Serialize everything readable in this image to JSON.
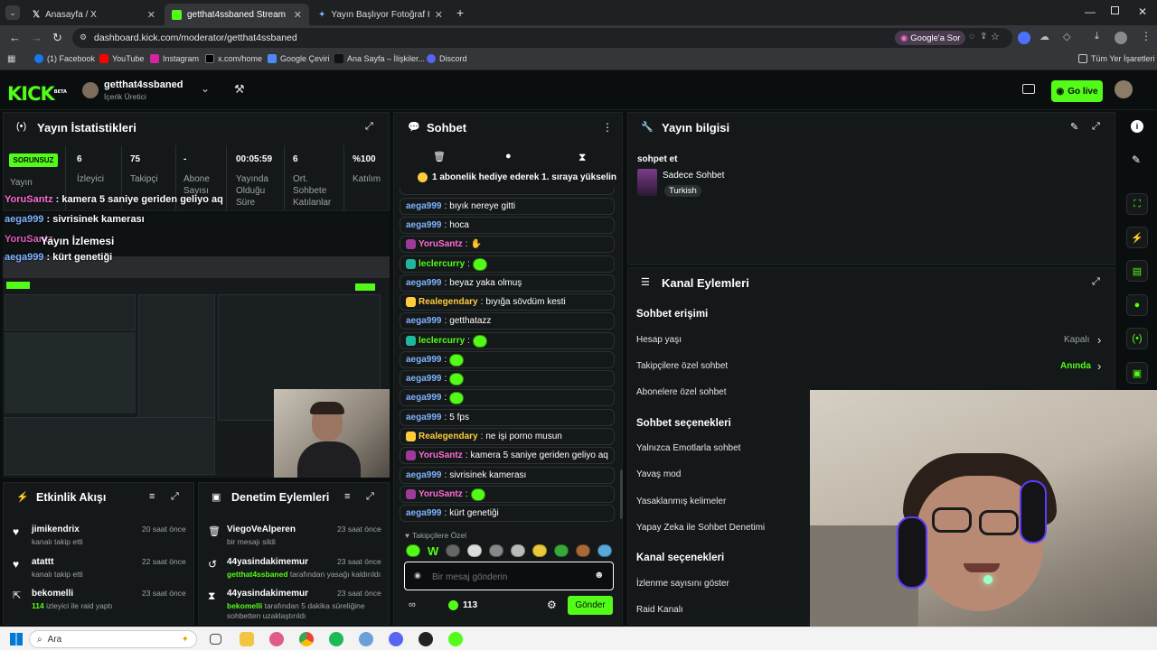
{
  "browser": {
    "tabs": [
      {
        "title": "Anasayfa / X"
      },
      {
        "title": "getthat4ssbaned Stream - Kick"
      },
      {
        "title": "Yayın Başlıyor Fotoğraf Hazırlan"
      }
    ],
    "url": "dashboard.kick.com/moderator/getthat4ssbaned",
    "ask_google": "Google'a Sor",
    "bookmarks": [
      "(1) Facebook",
      "YouTube",
      "Instagram",
      "x.com/home",
      "Google Çeviri",
      "Ana Sayfa – İlişkiler...",
      "Discord"
    ],
    "all_bookmarks": "Tüm Yer İşaretleri"
  },
  "kick": {
    "logo": "KICK",
    "beta": "BETA",
    "channel_name": "getthat4ssbaned",
    "channel_role": "İçerik Üretici",
    "go_live": "Go live"
  },
  "stats": {
    "title": "Yayın İstatistikleri",
    "status_badge": "SORUNSUZ",
    "status_label": "Yayın",
    "items": [
      {
        "value": "6",
        "label": "İzleyici"
      },
      {
        "value": "75",
        "label": "Takipçi"
      },
      {
        "value": "-",
        "label": "Abone Sayısı"
      },
      {
        "value": "00:05:59",
        "label": "Yayında Olduğu Süre"
      },
      {
        "value": "6",
        "label": "Ort. Sohbete Katılanlar"
      },
      {
        "value": "%100",
        "label": "Katılım"
      }
    ]
  },
  "stream_overlay": {
    "lines": [
      {
        "user": "YoruSantz",
        "text": " : kamera 5 saniye geriden geliyo aq"
      },
      {
        "user": "aega999",
        "text": " : sivrisinek kamerası"
      },
      {
        "user": "YoruSantz",
        "text": "Yayın İzlemesi"
      },
      {
        "user": "aega999",
        "text": " : kürt genetiği"
      }
    ]
  },
  "activity": {
    "title": "Etkinlik Akışı",
    "items": [
      {
        "user": "jimikendrix",
        "desc": "kanalı takip etti",
        "time": "20 saat önce"
      },
      {
        "user": "atattt",
        "desc": "kanalı takip etti",
        "time": "22 saat önce"
      },
      {
        "user": "bekomelli",
        "count": "114",
        "desc": "izleyici ile raid yaptı",
        "time": "23 saat önce"
      }
    ]
  },
  "moderation": {
    "title": "Denetim Eylemleri",
    "items": [
      {
        "user": "ViegoVeAlperen",
        "desc": "bir mesajı sildi",
        "time": "23 saat önce"
      },
      {
        "user": "44yasindakimemur",
        "actor": "getthat4ssbaned",
        "desc": "tarafından yasağı kaldırıldı",
        "time": "23 saat önce"
      },
      {
        "user": "44yasindakimemur",
        "actor": "bekomelli",
        "desc": "tarafından 5 dakika süreliğine sohbetten uzaklaştırıldı",
        "time": "23 saat önce"
      }
    ]
  },
  "chat": {
    "title": "Sohbet",
    "gift_banner": "1 abonelik hediye ederek 1. sıraya yükselin",
    "messages": [
      {
        "user": "aega999",
        "text": "bıyık nereye gitti",
        "color": "blue"
      },
      {
        "user": "aega999",
        "text": "hoca",
        "color": "blue"
      },
      {
        "user": "YoruSantz",
        "text": "",
        "color": "pink",
        "emote": "hand"
      },
      {
        "user": "leclercurry",
        "text": "",
        "color": "green",
        "emote": "kick"
      },
      {
        "user": "aega999",
        "text": "beyaz yaka olmuş",
        "color": "blue"
      },
      {
        "user": "Realegendary",
        "text": "bıyığa sövdüm kesti",
        "color": "yellow"
      },
      {
        "user": "aega999",
        "text": "getthatazz",
        "color": "blue"
      },
      {
        "user": "leclercurry",
        "text": "",
        "color": "green",
        "emote": "kick"
      },
      {
        "user": "aega999",
        "text": "",
        "color": "blue",
        "emote": "kick"
      },
      {
        "user": "aega999",
        "text": "",
        "color": "blue",
        "emote": "kick"
      },
      {
        "user": "aega999",
        "text": "",
        "color": "blue",
        "emote": "kick"
      },
      {
        "user": "aega999",
        "text": "5 fps",
        "color": "blue"
      },
      {
        "user": "Realegendary",
        "text": "ne işi porno musun",
        "color": "yellow"
      },
      {
        "user": "YoruSantz",
        "text": "kamera 5 saniye geriden geliyo aq",
        "color": "pink"
      },
      {
        "user": "aega999",
        "text": "sivrisinek kamerası",
        "color": "blue"
      },
      {
        "user": "YoruSantz",
        "text": "",
        "color": "pink",
        "emote": "kick"
      },
      {
        "user": "aega999",
        "text": "kürt genetiği",
        "color": "blue"
      }
    ],
    "follower_only": "Takipçilere Özel",
    "input_placeholder": "Bir mesaj gönderin",
    "points": "113",
    "send": "Gönder"
  },
  "stream_info": {
    "title": "Yayın bilgisi",
    "stream_title": "sohpet et",
    "category": "Sadece Sohbet",
    "language": "Turkish"
  },
  "channel_actions": {
    "title": "Kanal Eylemleri",
    "sections": [
      {
        "heading": "Sohbet erişimi"
      },
      {
        "heading": "Sohbet seçenekleri"
      },
      {
        "heading": "Kanal seçenekleri"
      }
    ],
    "rows": [
      {
        "label": "Hesap yaşı",
        "value": "Kapalı"
      },
      {
        "label": "Takipçilere özel sohbet",
        "value": "Anında"
      },
      {
        "label": "Abonelere özel sohbet",
        "value": ""
      },
      {
        "label": "Yalnızca Emotlarla sohbet",
        "value": ""
      },
      {
        "label": "Yavaş mod",
        "value": ""
      },
      {
        "label": "Yasaklanmış kelimeler",
        "value": ""
      },
      {
        "label": "Yapay Zeka ile Sohbet Denetimi",
        "value": ""
      },
      {
        "label": "İzlenme sayısını göster",
        "value": ""
      },
      {
        "label": "Raid Kanalı",
        "value": ""
      }
    ]
  },
  "taskbar": {
    "search": "Ara"
  },
  "colors": {
    "accent": "#53fc18",
    "panel": "#141819",
    "background": "#0b0e0f"
  }
}
